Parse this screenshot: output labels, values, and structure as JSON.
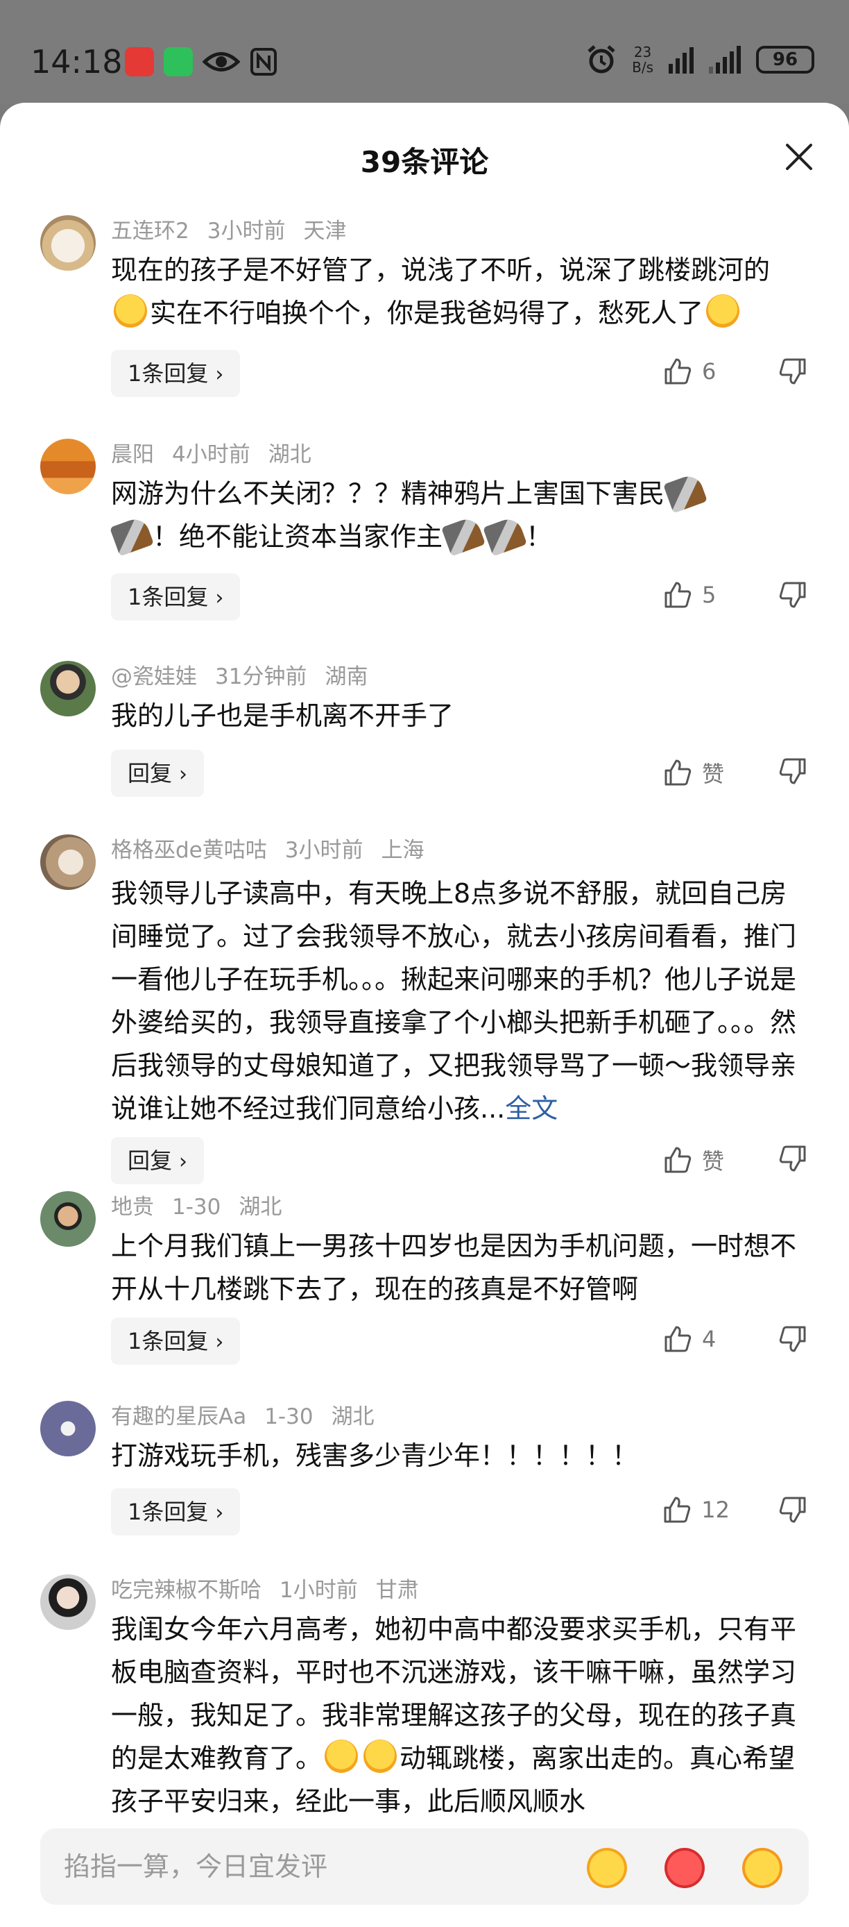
{
  "status_bar": {
    "time": "14:18",
    "net_speed_value": "23",
    "net_speed_unit": "B/s",
    "battery": "96"
  },
  "sheet": {
    "title": "39条评论"
  },
  "comments": [
    {
      "user": "五连环2",
      "time": "3小时前",
      "location": "天津",
      "text_1": "现在的孩子是不好管了，说浅了不听，说深了跳楼跳河的",
      "text_2": "实在不行咱换个个，你是我爸妈得了，愁死人了",
      "reply_label": "1条回复",
      "likes": "6"
    },
    {
      "user": "晨阳",
      "time": "4小时前",
      "location": "湖北",
      "text_1": "网游为什么不关闭？？？精神鸦片上害国下害民",
      "text_2": "！绝不能让资本当家作主",
      "text_3": "！",
      "reply_label": "1条回复",
      "likes": "5"
    },
    {
      "user": "@瓷娃娃",
      "time": "31分钟前",
      "location": "湖南",
      "text": "我的儿子也是手机离不开手了",
      "reply_label": "回复",
      "likes": "赞"
    },
    {
      "user": "格格巫de黄咕咕",
      "time": "3小时前",
      "location": "上海",
      "text": "我领导儿子读高中，有天晚上8点多说不舒服，就回自己房间睡觉了。过了会我领导不放心，就去小孩房间看看，推门一看他儿子在玩手机。。。揪起来问哪来的手机？他儿子说是外婆给买的，我领导直接拿了个小榔头把新手机砸了。。。然后我领导的丈母娘知道了，又把我领导骂了一顿～我领导亲说谁让她不经过我们同意给小孩...",
      "more_label": "全文",
      "reply_label": "回复",
      "likes": "赞"
    },
    {
      "user": "地贵",
      "time": "1-30",
      "location": "湖北",
      "text": "上个月我们镇上一男孩十四岁也是因为手机问题，一时想不开从十几楼跳下去了，现在的孩真是不好管啊",
      "reply_label": "1条回复",
      "likes": "4"
    },
    {
      "user": "有趣的星辰Aa",
      "time": "1-30",
      "location": "湖北",
      "text": "打游戏玩手机，残害多少青少年！！！！！！",
      "reply_label": "1条回复",
      "likes": "12"
    },
    {
      "user": "吃完辣椒不斯哈",
      "time": "1小时前",
      "location": "甘肃",
      "text_1": "我闺女今年六月高考，她初中高中都没要求买手机，只有平板电脑查资料，平时也不沉迷游戏，该干嘛干嘛，虽然学习一般，我知足了。我非常理解这孩子的父母，现在的孩子真的是太难教育了。",
      "text_2": "动辄跳楼，离家出走的。真心希望孩子平安归来，经此一事，此后顺风顺水"
    }
  ],
  "input": {
    "placeholder": "掐指一算，今日宜发评"
  },
  "icons": {
    "like": "thumbs-up-icon",
    "dislike": "thumbs-down-icon",
    "close": "close-icon"
  }
}
